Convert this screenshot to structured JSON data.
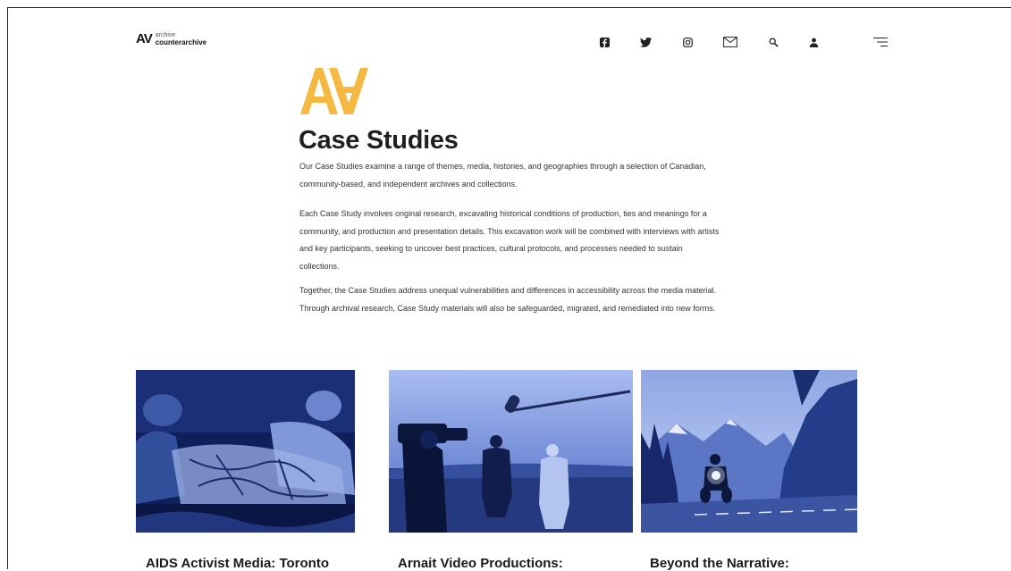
{
  "header": {
    "brand_mark": "AV",
    "brand_line1": "archive",
    "brand_line2": "counterarchive",
    "icons": [
      "facebook-icon",
      "twitter-icon",
      "instagram-icon",
      "mail-icon",
      "search-icon",
      "user-icon",
      "menu-icon"
    ]
  },
  "hero": {
    "logo": "AV logo",
    "title": "Case Studies",
    "paragraphs": [
      "Our Case Studies examine a range of themes, media, histories, and geographies through a selection of Canadian, community-based, and independent archives and collections.",
      "Each Case Study involves original research, excavating historical conditions of production, ties and meanings for a community, and production and presentation details. This excavation work will be combined with interviews with artists and key participants, seeking to uncover best practices, cultural protocols, and processes needed to sustain collections.",
      "Together, the Case Studies address unequal vulnerabilities and differences in accessibility across the media material. Through archival research, Case Study materials will also be safeguarded, migrated, and remediated into new forms."
    ]
  },
  "colors": {
    "accent": "#f5b942",
    "duotone_dark": "#0b1a4a",
    "duotone_light": "#8fa8e8"
  },
  "cards": [
    {
      "title": "AIDS Activist Media: Toronto"
    },
    {
      "title": "Arnait Video Productions:"
    },
    {
      "title": "Beyond the Narrative:"
    }
  ]
}
